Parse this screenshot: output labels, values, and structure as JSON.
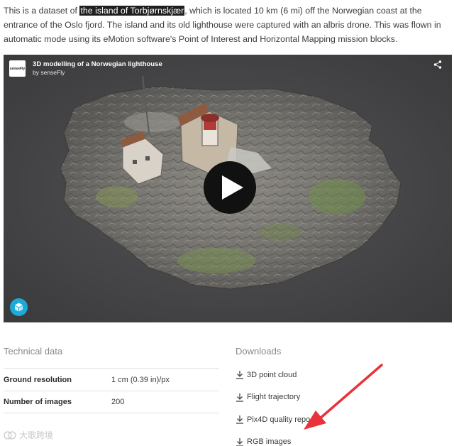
{
  "intro": {
    "before": "This is a dataset of ",
    "highlight": "the island of Torbjørnskjær",
    "after": ", which is located 10 km (6 mi) off the Norwegian coast at the entrance of the Oslo fjord. The island and its old lighthouse were captured with an albris drone. This was flown in automatic mode using its eMotion software's Point of Interest and Horizontal Mapping mission blocks."
  },
  "viewer": {
    "logo_text": "senseFly",
    "title": "3D modelling of a Norwegian lighthouse",
    "byline": "by senseFly",
    "icons": {
      "share": "share-icon",
      "play": "play-icon",
      "badge": "sketchfab-icon"
    }
  },
  "technical": {
    "title": "Technical data",
    "rows": [
      {
        "label": "Ground resolution",
        "value": "1 cm (0.39 in)/px"
      },
      {
        "label": "Number of images",
        "value": "200"
      }
    ]
  },
  "downloads": {
    "title": "Downloads",
    "items": [
      {
        "label": "3D point cloud"
      },
      {
        "label": "Flight trajectory"
      },
      {
        "label": "Pix4D quality repo"
      },
      {
        "label": "RGB images"
      }
    ]
  },
  "annotation": {
    "arrow_color": "#e8333a"
  },
  "watermark": {
    "text": "大歌跨境"
  },
  "colors": {
    "accent": "#1caad9",
    "highlight_bg": "#1f1f1f"
  }
}
